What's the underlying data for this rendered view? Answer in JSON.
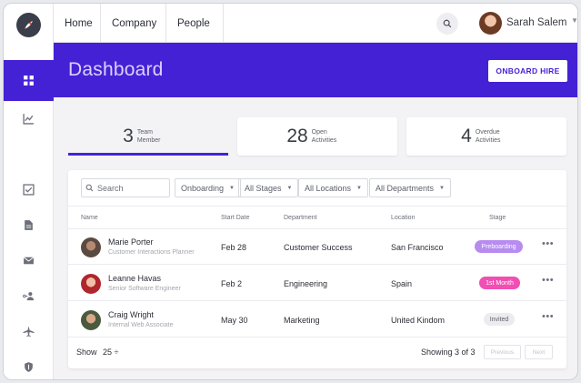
{
  "app": {
    "brand_color": "#4521d6"
  },
  "topnav": {
    "items": [
      "Home",
      "Company",
      "People"
    ],
    "user_name": "Sarah Salem"
  },
  "sidebar": {
    "icons": [
      "dashboard-icon",
      "chart-icon",
      "checkbox-icon",
      "document-icon",
      "mail-icon",
      "person-key-icon",
      "airplane-icon",
      "shield-icon"
    ],
    "active": "dashboard-icon"
  },
  "header": {
    "title": "Dashboard",
    "action_label": "ONBOARD HIRE"
  },
  "stats": [
    {
      "value": "3",
      "label_line1": "Team",
      "label_line2": "Member"
    },
    {
      "value": "28",
      "label_line1": "Open",
      "label_line2": "Activities"
    },
    {
      "value": "4",
      "label_line1": "Overdue",
      "label_line2": "Activities"
    }
  ],
  "filters": {
    "search_placeholder": "Search",
    "dropdowns": [
      "Onboarding",
      "All Stages",
      "All Locations",
      "All Departments"
    ]
  },
  "table": {
    "columns": [
      "Name",
      "Start Date",
      "Department",
      "Location",
      "Stage"
    ],
    "rows": [
      {
        "name": "Marie Porter",
        "role": "Customer Interactions Planner",
        "start": "Feb 28",
        "department": "Customer Success",
        "location": "San Francisco",
        "stage": "Preboarding",
        "stage_bg": "#b68cf0",
        "stage_fg": "#ffffff"
      },
      {
        "name": "Leanne Havas",
        "role": "Senior Software Engineer",
        "start": "Feb 2",
        "department": "Engineering",
        "location": "Spain",
        "stage": "1st Month",
        "stage_bg": "#f04fb3",
        "stage_fg": "#ffffff"
      },
      {
        "name": "Craig Wright",
        "role": "Internal Web Associate",
        "start": "May 30",
        "department": "Marketing",
        "location": "United Kindom",
        "stage": "Invited",
        "stage_bg": "#ececef",
        "stage_fg": "#5e6069"
      }
    ],
    "more_label": "•••"
  },
  "footer": {
    "show_label": "Show",
    "page_size": "25 ÷",
    "showing": "Showing 3 of 3",
    "previous": "Previous",
    "next": "Next"
  }
}
